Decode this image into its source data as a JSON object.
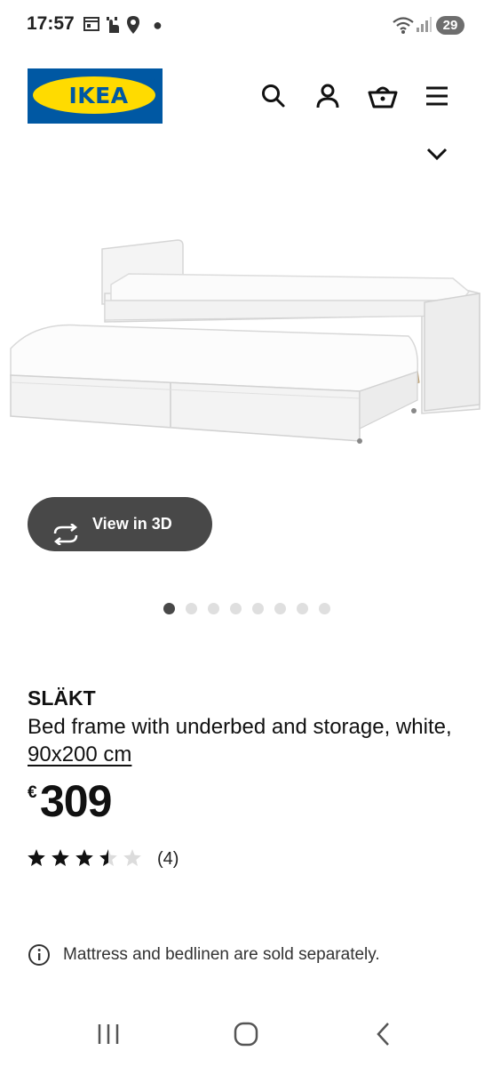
{
  "status_bar": {
    "time": "17:57",
    "icons": [
      "calendar-icon",
      "tap-icon",
      "location-icon",
      "dot-icon",
      "wifi-icon",
      "signal-icon"
    ],
    "battery": "29"
  },
  "header": {
    "logo_text": "IKEA",
    "logo_registered": "®",
    "icons": [
      "search-icon",
      "profile-icon",
      "basket-icon",
      "menu-icon",
      "chevron-down-icon"
    ],
    "colors": {
      "logo_blue": "#0058A3",
      "logo_yellow": "#FFDB00"
    }
  },
  "gallery": {
    "view3d_label": "View in 3D",
    "image_count": 8,
    "active_index": 0
  },
  "product": {
    "name": "SLÄKT",
    "description": "Bed frame with underbed and storage, white,",
    "size": "90x200 cm",
    "currency": "€",
    "price": "309",
    "rating": 3.5,
    "rating_max": 5,
    "reviews": "(4)"
  },
  "notice": {
    "text": "Mattress and bedlinen are sold separately."
  },
  "nav": {
    "icons": [
      "recent-apps-icon",
      "home-icon",
      "back-icon"
    ]
  }
}
